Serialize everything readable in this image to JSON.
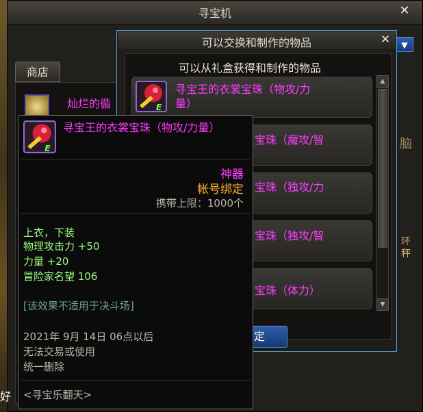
{
  "main_window": {
    "title": "寻宝机",
    "close_symbol": "✕"
  },
  "shop": {
    "tab_label": "商店",
    "item_name": "灿烂的循"
  },
  "dropdown": {
    "arrow_symbol": "▼"
  },
  "exchange_panel": {
    "title": "可以交换和制作的物品",
    "close_symbol": "✕",
    "subtitle": "可以从礼盒获得和制作的物品",
    "items": [
      {
        "line1": "寻宝王的衣裳宝珠（物攻/力",
        "line2": "量）"
      },
      {
        "line1": "宝珠（魔攻/智"
      },
      {
        "line1": "宝珠（独攻/力"
      },
      {
        "line1": "宝珠（独攻/智"
      },
      {
        "line1": "宝珠（体力）"
      }
    ],
    "confirm_label": "定"
  },
  "tooltip": {
    "item_name": "寻宝王的衣裳宝珠（物攻/力量）",
    "rarity": "神器",
    "bind": "帐号绑定",
    "stack_limit": "携带上限：1000个",
    "slots": "上衣，下装",
    "stats": [
      "物理攻击力 +50",
      "力量 +20",
      "冒险家名望 106"
    ],
    "pvp_note": "[该效果不适用于决斗场]",
    "expiry_line1": "2021年 9月 14日 06点以后",
    "expiry_line2": "无法交易或使用",
    "expiry_line3": "统一删除",
    "source": "<寻宝乐翻天>"
  },
  "background_fragments": {
    "right_1": "脑",
    "right_2": "环",
    "right_3": "秤",
    "left_bottom": "好"
  },
  "colors": {
    "epic_pink": "#ff3cff",
    "bind_orange": "#ffb030",
    "stat_green": "#9cff7e",
    "accent_blue": "#2e5fa8"
  },
  "icons": [
    "close-icon",
    "dropdown-arrow-icon",
    "orb-hammer-icon",
    "scroll-up-icon",
    "scroll-down-icon"
  ]
}
